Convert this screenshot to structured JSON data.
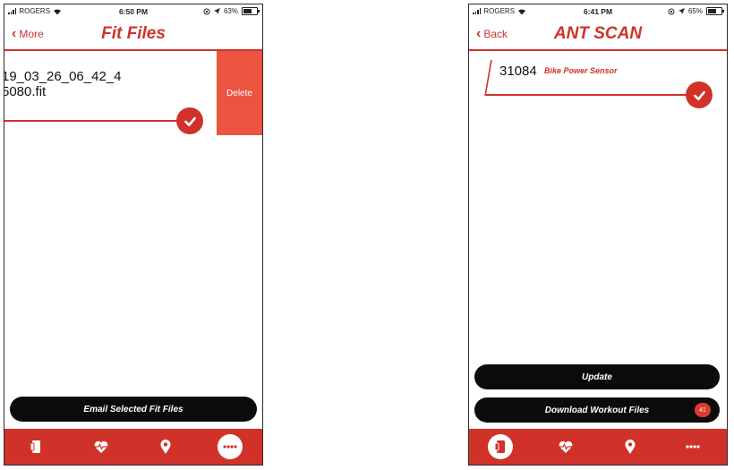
{
  "colors": {
    "accent": "#d0322a",
    "delete": "#ec5441",
    "pill": "#0b0b0b"
  },
  "left_screen": {
    "status": {
      "carrier": "ROGERS",
      "time": "6:50 PM",
      "battery_text": "63%",
      "battery_level": 0.63
    },
    "nav": {
      "back_label": "More",
      "title": "Fit Files"
    },
    "file": {
      "line1": "19_03_26_06_42_4",
      "line2": "5080.fit"
    },
    "delete_label": "Delete",
    "email_button": "Email Selected Fit Files",
    "tabs": [
      "device-icon",
      "heart-rate-icon",
      "location-pin-icon",
      "more-icon"
    ],
    "active_tab": "more-icon"
  },
  "right_screen": {
    "status": {
      "carrier": "ROGERS",
      "time": "6:41 PM",
      "battery_text": "65%",
      "battery_level": 0.65
    },
    "nav": {
      "back_label": "Back",
      "title": "ANT SCAN"
    },
    "sensor": {
      "id": "31084",
      "type": "Bike Power Sensor"
    },
    "update_button": "Update",
    "download_button": "Download Workout Files",
    "download_badge": "41",
    "tabs": [
      "device-icon",
      "heart-rate-icon",
      "location-pin-icon",
      "more-icon"
    ],
    "active_tab": "device-icon"
  }
}
